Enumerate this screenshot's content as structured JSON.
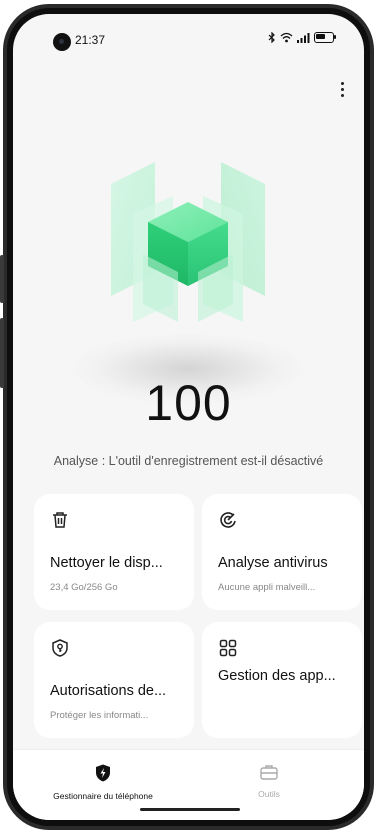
{
  "status_bar": {
    "time": "21:37",
    "icons": [
      "bluetooth-icon",
      "wifi-icon",
      "signal-icon",
      "battery-icon"
    ]
  },
  "header": {
    "more_icon": "more-vertical-icon"
  },
  "hero": {
    "illustration": "green-cube-icon",
    "score": "100",
    "status_message": "Analyse : L'outil d'enregistrement est-il désactivé"
  },
  "cards": [
    {
      "icon": "trash-icon",
      "title": "Nettoyer le disp...",
      "subtitle": "23,4 Go/256 Go"
    },
    {
      "icon": "antivirus-radar-icon",
      "title": "Analyse antivirus",
      "subtitle": "Aucune appli malveill..."
    },
    {
      "icon": "shield-key-icon",
      "title": "Autorisations de...",
      "subtitle": "Protéger les informati..."
    },
    {
      "icon": "app-grid-icon",
      "title": "Gestion des app...",
      "subtitle": ""
    }
  ],
  "bottom_nav": {
    "items": [
      {
        "icon": "shield-bolt-icon",
        "label": "Gestionnaire du téléphone",
        "active": true
      },
      {
        "icon": "toolbox-icon",
        "label": "Outils",
        "active": false
      }
    ]
  },
  "colors": {
    "accent_green": "#3cd68a",
    "active_text": "#111111",
    "inactive_text": "#aaaaaa",
    "background": "#f6f6f6",
    "card": "#ffffff"
  }
}
